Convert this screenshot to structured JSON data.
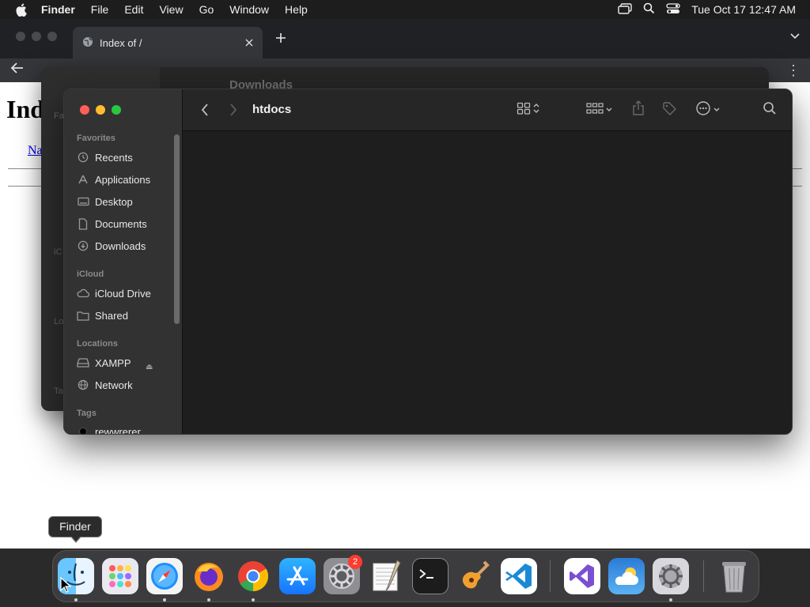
{
  "menubar": {
    "app_name": "Finder",
    "menus": [
      "File",
      "Edit",
      "View",
      "Go",
      "Window",
      "Help"
    ],
    "clock": "Tue Oct 17  12:47 AM"
  },
  "browser": {
    "tab_title": "Index of /",
    "page_heading": "Ind",
    "link_text": "Na"
  },
  "background_finder": {
    "title": "Downloads",
    "sidebar_labels": [
      "Fa",
      "iC",
      "Lo",
      "Ta"
    ]
  },
  "finder": {
    "title": "htdocs",
    "sections": {
      "favorites": "Favorites",
      "icloud": "iCloud",
      "locations": "Locations",
      "tags": "Tags"
    },
    "favorites": [
      {
        "label": "Recents",
        "icon": "clock-icon"
      },
      {
        "label": "Applications",
        "icon": "applications-icon"
      },
      {
        "label": "Desktop",
        "icon": "desktop-icon"
      },
      {
        "label": "Documents",
        "icon": "document-icon"
      },
      {
        "label": "Downloads",
        "icon": "download-icon"
      }
    ],
    "icloud": [
      {
        "label": "iCloud Drive",
        "icon": "cloud-icon"
      },
      {
        "label": "Shared",
        "icon": "shared-folder-icon"
      }
    ],
    "locations": [
      {
        "label": "XAMPP",
        "icon": "drive-icon"
      },
      {
        "label": "Network",
        "icon": "globe-icon"
      }
    ],
    "tags": [
      {
        "label": "rewwrerer",
        "color": "#000000"
      }
    ]
  },
  "tooltip": {
    "text": "Finder"
  },
  "dock": {
    "settings_badge": "2",
    "apps": [
      "Finder",
      "Launchpad",
      "Safari",
      "Firefox",
      "Chrome",
      "App Store",
      "System Preferences",
      "TextEdit",
      "Terminal",
      "GarageBand",
      "Visual Studio Code",
      "Visual Studio",
      "Weather",
      "System Settings",
      "Trash"
    ]
  },
  "colors": {
    "traffic_red": "#ff5f57",
    "traffic_yellow": "#febc2e",
    "traffic_green": "#28c840",
    "link": "#0000ee",
    "badge": "#ff3b30"
  }
}
